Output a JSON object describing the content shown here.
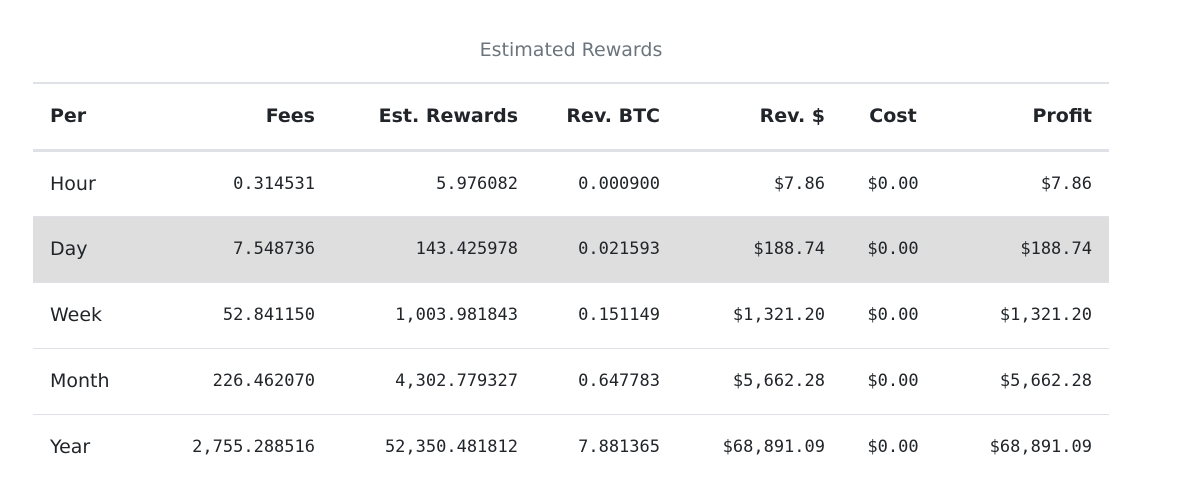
{
  "caption": "Estimated Rewards",
  "table": {
    "headers": [
      "Per",
      "Fees",
      "Est. Rewards",
      "Rev. BTC",
      "Rev. $",
      "Cost",
      "Profit"
    ],
    "rows": [
      [
        "Hour",
        "0.314531",
        "5.976082",
        "0.000900",
        "$7.86",
        "$0.00",
        "$7.86"
      ],
      [
        "Day",
        "7.548736",
        "143.425978",
        "0.021593",
        "$188.74",
        "$0.00",
        "$188.74"
      ],
      [
        "Week",
        "52.841150",
        "1,003.981843",
        "0.151149",
        "$1,321.20",
        "$0.00",
        "$1,321.20"
      ],
      [
        "Month",
        "226.462070",
        "4,302.779327",
        "0.647783",
        "$5,662.28",
        "$0.00",
        "$5,662.28"
      ],
      [
        "Year",
        "2,755.288516",
        "52,350.481812",
        "7.881365",
        "$68,891.09",
        "$0.00",
        "$68,891.09"
      ]
    ]
  },
  "colors": {
    "caption_text": "#6c757d",
    "row_highlight": "#dedede",
    "border": "#dee2e6"
  }
}
